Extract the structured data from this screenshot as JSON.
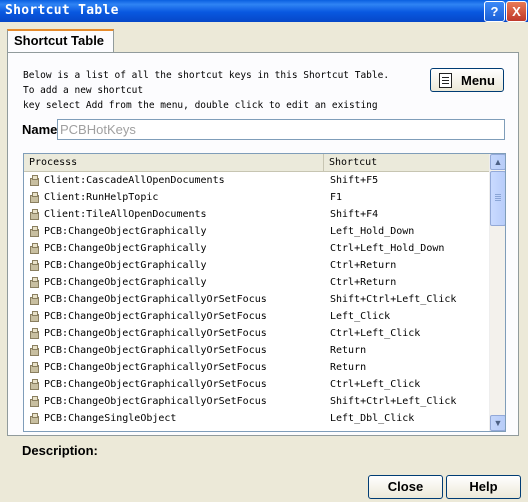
{
  "window": {
    "title": "Shortcut Table",
    "help_button": "?",
    "close_button": "X"
  },
  "tab": {
    "label": "Shortcut Table"
  },
  "description_lines": [
    "Below is a list of all the shortcut keys in this Shortcut Table.",
    "To add a new shortcut",
    "key select Add from the menu, double click to edit an existing"
  ],
  "menu_button": {
    "label": "Menu"
  },
  "name_field": {
    "label": "Name",
    "value": "PCBHotKeys"
  },
  "table": {
    "columns": [
      "Processs",
      "Shortcut"
    ],
    "rows": [
      {
        "process": "Client:CascadeAllOpenDocuments",
        "shortcut": "Shift+F5"
      },
      {
        "process": "Client:RunHelpTopic",
        "shortcut": "F1"
      },
      {
        "process": "Client:TileAllOpenDocuments",
        "shortcut": "Shift+F4"
      },
      {
        "process": "PCB:ChangeObjectGraphically",
        "shortcut": "Left_Hold_Down"
      },
      {
        "process": "PCB:ChangeObjectGraphically",
        "shortcut": "Ctrl+Left_Hold_Down"
      },
      {
        "process": "PCB:ChangeObjectGraphically",
        "shortcut": "Ctrl+Return"
      },
      {
        "process": "PCB:ChangeObjectGraphically",
        "shortcut": "Ctrl+Return"
      },
      {
        "process": "PCB:ChangeObjectGraphicallyOrSetFocus",
        "shortcut": "Shift+Ctrl+Left_Click"
      },
      {
        "process": "PCB:ChangeObjectGraphicallyOrSetFocus",
        "shortcut": "Left_Click"
      },
      {
        "process": "PCB:ChangeObjectGraphicallyOrSetFocus",
        "shortcut": "Ctrl+Left_Click"
      },
      {
        "process": "PCB:ChangeObjectGraphicallyOrSetFocus",
        "shortcut": "Return"
      },
      {
        "process": "PCB:ChangeObjectGraphicallyOrSetFocus",
        "shortcut": "Return"
      },
      {
        "process": "PCB:ChangeObjectGraphicallyOrSetFocus",
        "shortcut": "Ctrl+Left_Click"
      },
      {
        "process": "PCB:ChangeObjectGraphicallyOrSetFocus",
        "shortcut": "Shift+Ctrl+Left_Click"
      },
      {
        "process": "PCB:ChangeSingleObject",
        "shortcut": "Left_Dbl_Click"
      }
    ]
  },
  "description_label": "Description:",
  "buttons": {
    "close": "Close",
    "help": "Help"
  }
}
